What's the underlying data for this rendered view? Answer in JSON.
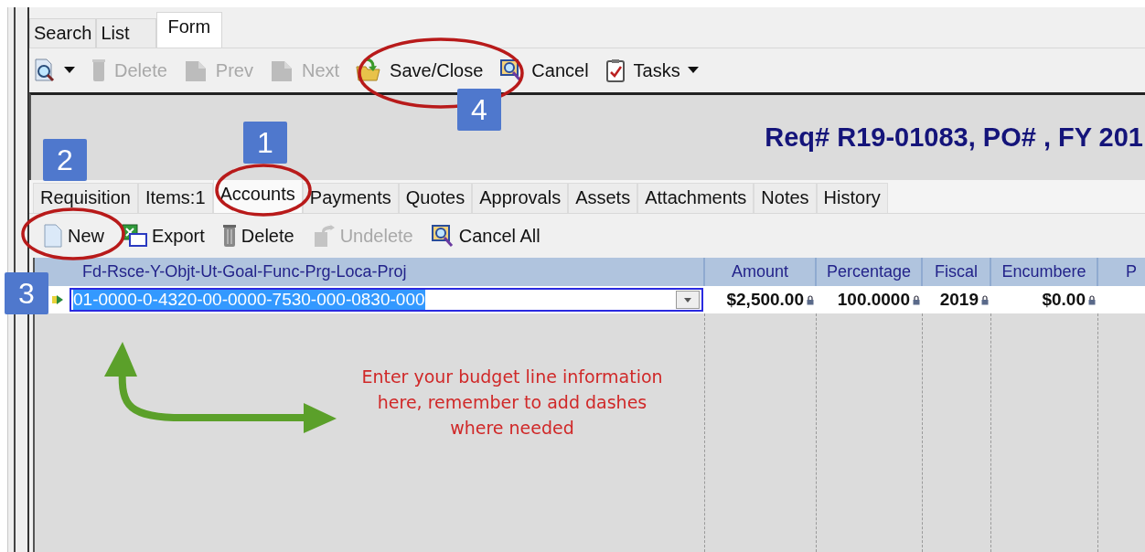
{
  "window_tabs": [
    {
      "label": "Search",
      "selected": false
    },
    {
      "label": "List",
      "selected": false
    },
    {
      "label": "Form",
      "selected": true
    }
  ],
  "toolbar": [
    {
      "kind": "dropdown",
      "disabled": false
    },
    {
      "kind": "button",
      "label": "Delete",
      "disabled": true
    },
    {
      "kind": "button",
      "label": "Prev",
      "disabled": true
    },
    {
      "kind": "button",
      "label": "Next",
      "disabled": true
    },
    {
      "kind": "button",
      "label": "Save/Close",
      "disabled": false
    },
    {
      "kind": "button",
      "label": "Cancel",
      "disabled": false
    },
    {
      "kind": "dropdown",
      "label": "Tasks",
      "disabled": false
    }
  ],
  "record_title": "Req# R19-01083, PO# , FY 201",
  "form_tabs": [
    {
      "label": "Requisition",
      "selected": false
    },
    {
      "label": "Items:1",
      "selected": false
    },
    {
      "label": "Accounts",
      "selected": true
    },
    {
      "label": "Payments",
      "selected": false
    },
    {
      "label": "Quotes",
      "selected": false
    },
    {
      "label": "Approvals",
      "selected": false
    },
    {
      "label": "Assets",
      "selected": false
    },
    {
      "label": "Attachments",
      "selected": false
    },
    {
      "label": "Notes",
      "selected": false
    },
    {
      "label": "History",
      "selected": false
    }
  ],
  "accounts_toolbar": [
    {
      "label": "New",
      "disabled": false
    },
    {
      "label": "Export",
      "disabled": false
    },
    {
      "label": "Delete",
      "disabled": false
    },
    {
      "label": "Undelete",
      "disabled": true
    },
    {
      "label": "Cancel All",
      "disabled": false
    }
  ],
  "table": {
    "columns": [
      "Fd-Rsce-Y-Objt-Ut-Goal-Func-Prg-Loca-Proj",
      "Amount",
      "Percentage",
      "Fiscal",
      "Encumbere",
      "P"
    ],
    "rows": [
      {
        "cells": [
          {
            "value": "01-0000-0-4320-00-0000-7530-000-0830-000",
            "locked": false
          },
          {
            "value": "$2,500.00",
            "locked": true
          },
          {
            "value": "100.0000",
            "locked": true
          },
          {
            "value": "2019",
            "locked": true
          },
          {
            "value": "$0.00",
            "locked": true
          }
        ]
      }
    ]
  },
  "annotations": {
    "callouts": [
      "1",
      "2",
      "3",
      "4"
    ],
    "note": "Enter your budget line information\nhere, remember to add dashes\nwhere needed"
  }
}
